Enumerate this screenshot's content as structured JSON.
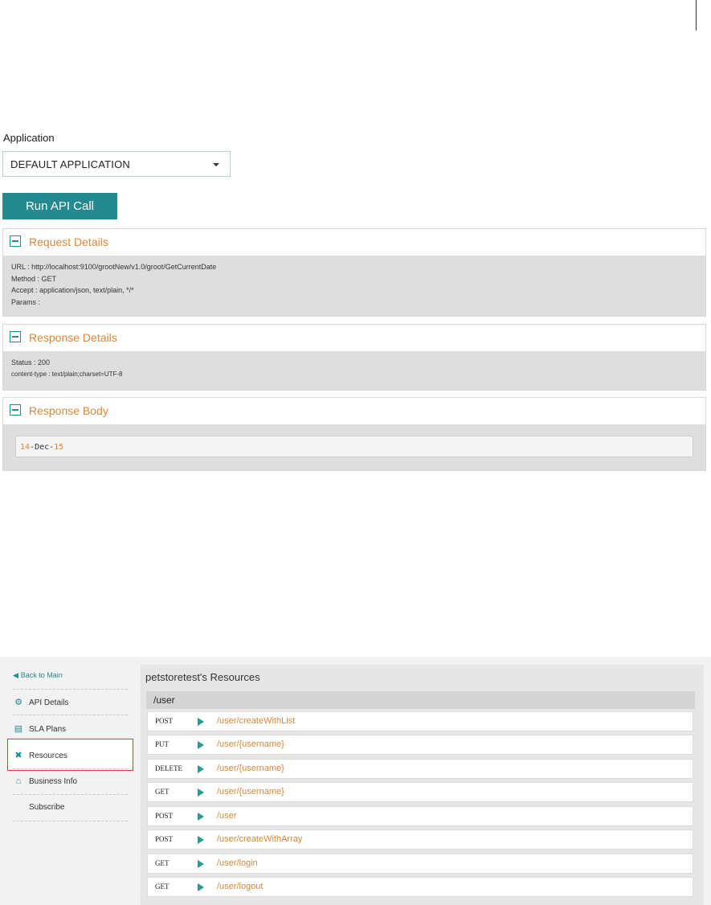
{
  "application": {
    "label": "Application",
    "selected": "DEFAULT APPLICATION",
    "run_label": "Run API Call"
  },
  "request_details": {
    "title": "Request Details",
    "url": "URL : http://localhost:9100/grootNew/v1.0/groot/GetCurrentDate",
    "method": "Method : GET",
    "accept": "Accept : application/json, text/plain, */*",
    "params": "Params :"
  },
  "response_details": {
    "title": "Response Details",
    "status": "Status : 200",
    "content_type": "content-type : text/plain;charset=UTF-8"
  },
  "response_body": {
    "title": "Response Body",
    "day": "14",
    "sep1": "-Dec-",
    "year": "15"
  },
  "sidebar": {
    "back": "Back to Main",
    "items": [
      {
        "label": "API Details",
        "icon": "gear-icon"
      },
      {
        "label": "SLA Plans",
        "icon": "chat-icon"
      },
      {
        "label": "Resources",
        "icon": "tools-icon"
      },
      {
        "label": "Business Info",
        "icon": "bank-icon"
      },
      {
        "label": "Subscribe",
        "icon": ""
      }
    ]
  },
  "resources": {
    "title": "petstoretest's Resources",
    "group": "/user",
    "endpoints": [
      {
        "method": "POST",
        "path": "/user/createWithList"
      },
      {
        "method": "PUT",
        "path": "/user/{username}"
      },
      {
        "method": "DELETE",
        "path": "/user/{username}"
      },
      {
        "method": "GET",
        "path": "/user/{username}"
      },
      {
        "method": "POST",
        "path": "/user"
      },
      {
        "method": "POST",
        "path": "/user/createWithArray"
      },
      {
        "method": "GET",
        "path": "/user/login"
      },
      {
        "method": "GET",
        "path": "/user/logout"
      }
    ]
  },
  "colors": {
    "accent_teal": "#238a8f",
    "accent_orange": "#d9883a",
    "selection_red": "#e2353a"
  }
}
